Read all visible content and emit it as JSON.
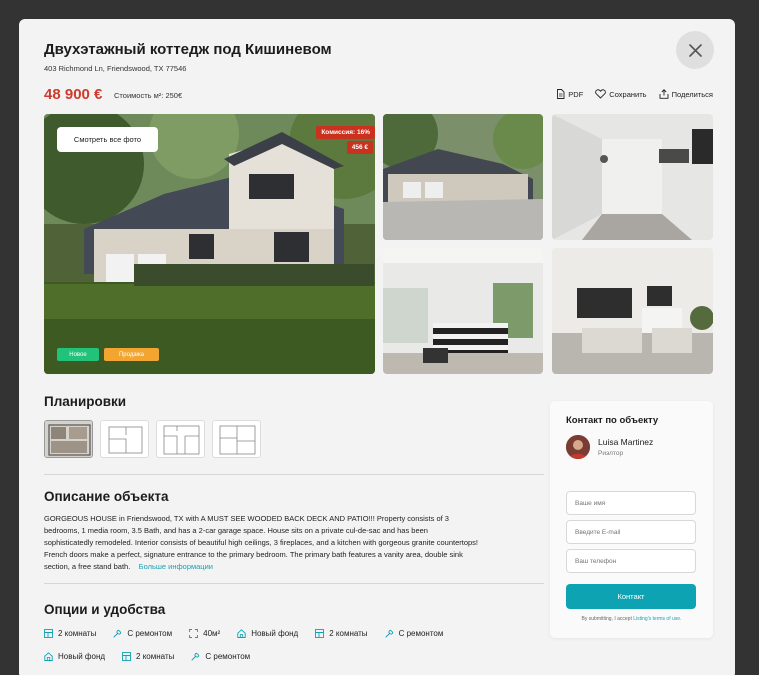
{
  "listing": {
    "title": "Двухэтажный коттедж под Кишиневом",
    "address": "403 Richmond Ln, Friendswood, TX 77546",
    "price": "48 900 €",
    "price_per_m2": "Стоимость м²: 250€"
  },
  "actions": {
    "pdf": "PDF",
    "save": "Сохранить",
    "share": "Поделиться"
  },
  "gallery": {
    "view_all": "Смотреть все фото",
    "commission": "Комиссия: 16%",
    "commission_amount": "456 €",
    "tag_new": "Новое",
    "tag_sale": "Продажа"
  },
  "layouts": {
    "heading": "Планировки"
  },
  "description": {
    "heading": "Описание объекта",
    "text": "GORGEOUS HOUSE in Friendswood, TX with A MUST SEE WOODED BACK DECK AND PATIO!!! Property consists of 3 bedrooms, 1 media room, 3.5 Bath, and has a 2-car garage space. House sits on a private cul-de-sac and has been sophisticatedly remodeled. Interior consists of beautiful high ceilings, 3 fireplaces, and a kitchen with gorgeous granite countertops! French doors make a perfect, signature entrance to the primary bedroom. The primary bath features a vanity area, double sink section, a free stand bath.",
    "more": "Больше информации"
  },
  "options": {
    "heading": "Опции и удобства",
    "row1": [
      {
        "icon": "layout-icon",
        "label": "2 комнаты"
      },
      {
        "icon": "wrench-icon",
        "label": "С ремонтом"
      },
      {
        "icon": "area-icon",
        "label": "40м²"
      },
      {
        "icon": "house-icon",
        "label": "Новый фонд"
      },
      {
        "icon": "layout-icon",
        "label": "2 комнаты"
      },
      {
        "icon": "wrench-icon",
        "label": "С ремонтом"
      }
    ],
    "row2": [
      {
        "icon": "house-icon",
        "label": "Новый фонд"
      },
      {
        "icon": "layout-icon",
        "label": "2 комнаты"
      },
      {
        "icon": "wrench-icon",
        "label": "С ремонтом"
      }
    ]
  },
  "contact": {
    "heading": "Контакт по объекту",
    "agent_name": "Luisa Martinez",
    "agent_role": "Риэлтор",
    "name_placeholder": "Ваше имя",
    "email_placeholder": "Введите E-mail",
    "phone_placeholder": "Ваш телефон",
    "submit": "Контакт",
    "terms_prefix": "By submitting, I accept",
    "terms_link": "Listing's terms of use."
  },
  "colors": {
    "price": "#cf3a2e",
    "accent": "#0ea3b3",
    "tag_new": "#21c27a",
    "tag_sale": "#f2a531",
    "commission": "#c9321f"
  }
}
